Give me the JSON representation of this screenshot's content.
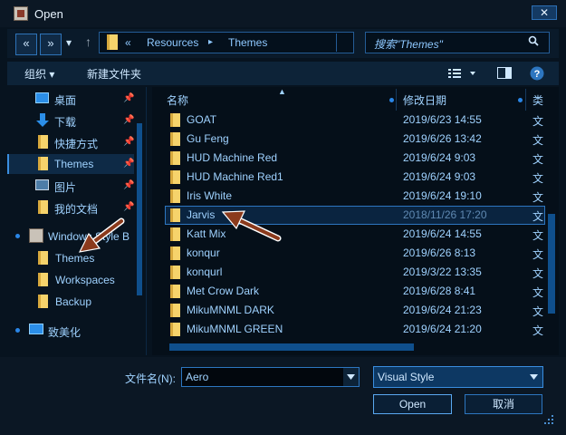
{
  "window": {
    "title": "Open",
    "close_glyph": "✕"
  },
  "nav": {
    "back_glyph": "«",
    "forward_glyph": "»",
    "dropdown_glyph": "▾",
    "up_glyph": "↑",
    "breadcrumb": [
      "Resources",
      "Themes"
    ],
    "breadcrumb_prefix": "«",
    "breadcrumb_sep": "▸",
    "search_placeholder": "搜索\"Themes\""
  },
  "toolbar": {
    "organize": "组织 ▾",
    "new_folder": "新建文件夹"
  },
  "sidebar": {
    "items": [
      {
        "label": "桌面",
        "icon": "desktop-icon",
        "pinned": true
      },
      {
        "label": "下载",
        "icon": "download-icon",
        "pinned": true
      },
      {
        "label": "快捷方式",
        "icon": "folder-icon",
        "pinned": true
      },
      {
        "label": "Themes",
        "icon": "folder-icon",
        "pinned": true,
        "selected": true
      },
      {
        "label": "图片",
        "icon": "pictures-icon",
        "pinned": true
      },
      {
        "label": "我的文档",
        "icon": "folder-icon",
        "pinned": true
      }
    ],
    "group": {
      "label": "Windows Style B",
      "icon": "app-icon"
    },
    "group_items": [
      "Themes",
      "Workspaces",
      "Backup"
    ],
    "pc": {
      "label": "致美化",
      "icon": "computer-icon"
    }
  },
  "list": {
    "columns": {
      "name": "名称",
      "date": "修改日期",
      "type": "类"
    },
    "rows": [
      {
        "name": "GOAT",
        "date": "2019/6/23 14:55",
        "type": "文"
      },
      {
        "name": "Gu Feng",
        "date": "2019/6/26 13:42",
        "type": "文"
      },
      {
        "name": "HUD Machine Red",
        "date": "2019/6/24 9:03",
        "type": "文"
      },
      {
        "name": "HUD Machine Red1",
        "date": "2019/6/24 9:03",
        "type": "文"
      },
      {
        "name": "Iris White",
        "date": "2019/6/24 19:10",
        "type": "文"
      },
      {
        "name": "Jarvis",
        "date": "2018/11/26 17:20",
        "type": "文",
        "selected": true
      },
      {
        "name": "Katt Mix",
        "date": "2019/6/24 14:55",
        "type": "文"
      },
      {
        "name": "konqur",
        "date": "2019/6/26 8:13",
        "type": "文"
      },
      {
        "name": "konqurl",
        "date": "2019/3/22 13:35",
        "type": "文"
      },
      {
        "name": "Met Crow Dark",
        "date": "2019/6/28 8:41",
        "type": "文"
      },
      {
        "name": "MikuMNML DARK",
        "date": "2019/6/24 21:23",
        "type": "文"
      },
      {
        "name": "MikuMNML GREEN",
        "date": "2019/6/24 21:20",
        "type": "文"
      }
    ]
  },
  "footer": {
    "filename_label": "文件名(N):",
    "filename_value": "Aero",
    "filetype_value": "Visual Style",
    "open_label": "Open",
    "cancel_label": "取消"
  },
  "colors": {
    "accent": "#2d76c0",
    "folder": "#f6d36b",
    "arrow": "#8b3a1c"
  }
}
